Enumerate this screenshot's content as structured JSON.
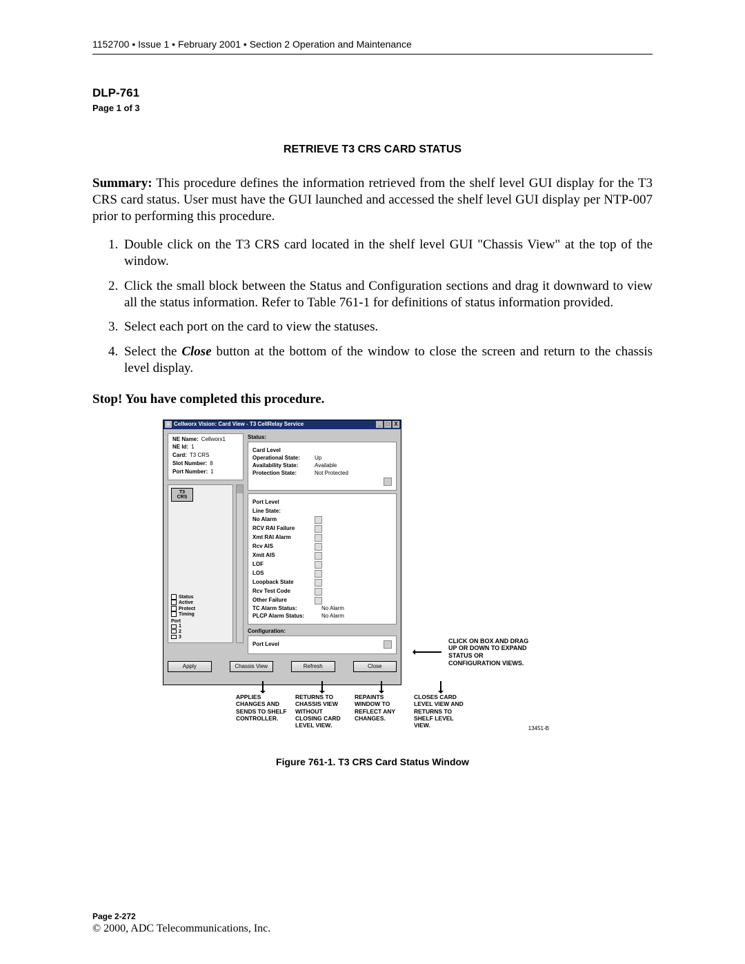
{
  "header": "1152700 • Issue 1 • February 2001 • Section 2 Operation and Maintenance",
  "dlp": "DLP-761",
  "page_of": "Page 1 of 3",
  "title": "RETRIEVE T3 CRS CARD STATUS",
  "summary_label": "Summary:",
  "summary_text": " This procedure defines the information retrieved from the shelf level GUI display for the T3 CRS card status. User must have the GUI launched and accessed the shelf level GUI display per NTP-007 prior to performing this procedure.",
  "steps": [
    "Double click on the T3 CRS card located in the shelf level GUI \"Chassis View\" at the top of the window.",
    "Click the small block between the Status and Configuration sections and drag it downward to view all the status information. Refer to Table 761-1 for definitions of status information provided.",
    "Select each port on the card to view the statuses.",
    ""
  ],
  "step4_pre": "Select the ",
  "step4_close": "Close",
  "step4_post": " button at the bottom of the window to close the screen and return to the chassis level display.",
  "stop": "Stop! You have completed this procedure.",
  "gui": {
    "title": "Cellworx Vision:   Card View - T3 CellRelay Service",
    "ne_name_k": "NE Name:",
    "ne_name_v": "Cellworx1",
    "ne_id_k": "NE Id:",
    "ne_id_v": "1",
    "card_k": "Card:",
    "card_v": "T3 CRS",
    "slot_k": "Slot Number:",
    "slot_v": "8",
    "port_k": "Port Number:",
    "port_v": "1",
    "chip_l1": "T3",
    "chip_l2": "CRS",
    "leg_status": "Status",
    "leg_active": "Active",
    "leg_protect": "Protect",
    "leg_timing": "Timing",
    "leg_port": "Port",
    "leg_p1": "1",
    "leg_p2": "2",
    "leg_p3": "3",
    "status_h": "Status:",
    "cardlevel_h": "Card Level",
    "op_k": "Operational State:",
    "op_v": "Up",
    "av_k": "Availability State:",
    "av_v": "Available",
    "pr_k": "Protection State:",
    "pr_v": "Not Protected",
    "portlevel_h": "Port Level",
    "linestate_h": "Line State:",
    "ls": [
      "No Alarm",
      "RCV RAI Failure",
      "Xmt RAI Alarm",
      "Rcv AIS",
      "Xmit AIS",
      "LOF",
      "LOS",
      "Loopback State",
      "Rcv Test Code",
      "Other Failure"
    ],
    "tc_k": "TC Alarm Status:",
    "tc_v": "No Alarm",
    "plcp_k": "PLCP Alarm Status:",
    "plcp_v": "No Alarm",
    "config_h": "Configuration:",
    "config_port_h": "Port Level",
    "buttons": [
      "Apply",
      "Chassis View",
      "Refresh",
      "Close"
    ]
  },
  "side_note": "CLICK ON BOX AND DRAG UP OR DOWN TO EXPAND STATUS OR CONFIGURATION VIEWS.",
  "callouts": [
    "APPLIES CHANGES AND SENDS TO SHELF CONTROLLER.",
    "RETURNS TO CHASSIS VIEW WITHOUT CLOSING CARD LEVEL VIEW.",
    "REPAINTS WINDOW TO REFLECT ANY CHANGES.",
    "CLOSES CARD LEVEL VIEW AND RETURNS TO SHELF LEVEL VIEW."
  ],
  "drawing_id": "13451-B",
  "fig_caption": "Figure 761-1.  T3 CRS Card Status Window",
  "footer_page": "Page 2-272",
  "footer_copy": "© 2000, ADC Telecommunications, Inc."
}
